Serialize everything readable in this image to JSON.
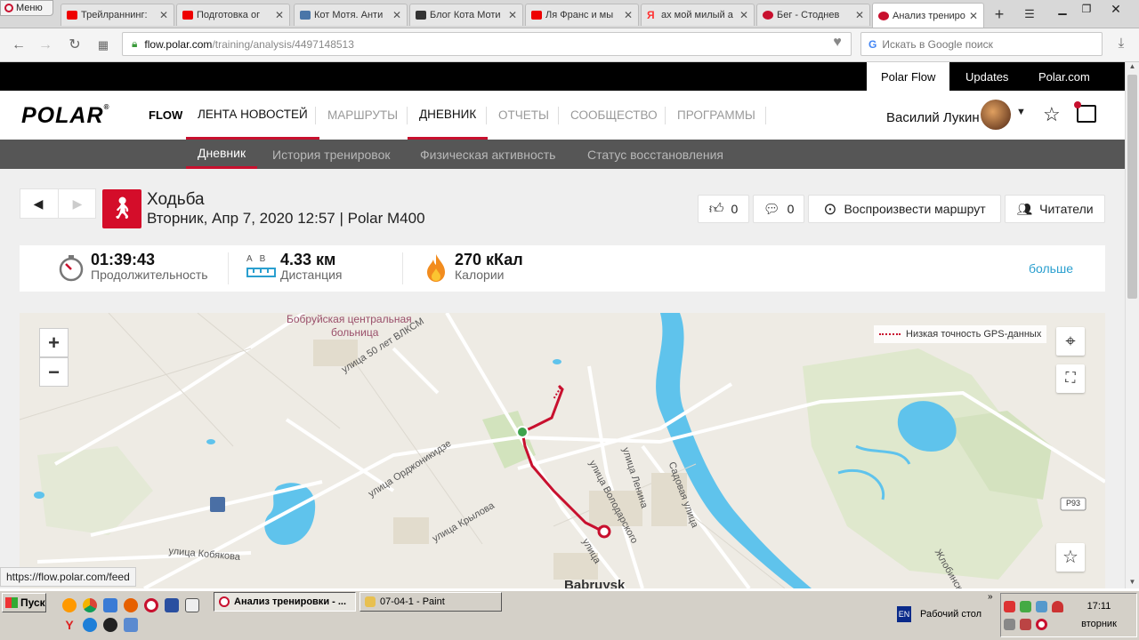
{
  "browser": {
    "menu_label": "Меню",
    "tabs": [
      {
        "title": "Трейлраннинг: ",
        "icon_color": "#e00"
      },
      {
        "title": "Подготовка ог",
        "icon_color": "#e00"
      },
      {
        "title": "Кот Мотя. Анти",
        "icon_color": "#4a76a8"
      },
      {
        "title": "Блог Кота Моти",
        "icon_color": "#333"
      },
      {
        "title": "Ля Франс и мы",
        "icon_color": "#e00"
      },
      {
        "title": "ах мой милый а",
        "icon_color": "#f33"
      },
      {
        "title": "Бег - Стоднев",
        "icon_color": "#c8102e"
      },
      {
        "title": "Анализ трениро",
        "icon_color": "#c8102e"
      }
    ],
    "url_domain": "flow.polar.com",
    "url_path": "/training/analysis/4497148513",
    "search_placeholder": "Искать в Google поиск",
    "status_url": "https://flow.polar.com/feed"
  },
  "polar": {
    "top_links": [
      "Polar Flow",
      "Updates",
      "Polar.com"
    ],
    "logo": "POLAR",
    "flow_label": "FLOW",
    "nav": [
      "ЛЕНТА НОВОСТЕЙ",
      "МАРШРУТЫ",
      "ДНЕВНИК",
      "ОТЧЕТЫ",
      "СООБЩЕСТВО",
      "ПРОГРАММЫ"
    ],
    "user_name": "Василий Лукин",
    "subnav": [
      "Дневник",
      "История тренировок",
      "Физическая активность",
      "Статус восстановления"
    ]
  },
  "session": {
    "sport": "Ходьба",
    "date_device": "Вторник, Апр 7, 2020 12:57 | Polar M400",
    "likes": "0",
    "comments": "0",
    "replay_label": "Воспроизвести маршрут",
    "readers_label": "Читатели"
  },
  "summary": {
    "duration_value": "01:39:43",
    "duration_label": "Продолжительность",
    "distance_value": "4.33 км",
    "distance_label": "Дистанция",
    "distance_icon_letters": "A  B",
    "calories_value": "270 кКал",
    "calories_label": "Калории",
    "more_label": "больше"
  },
  "map": {
    "gps_note": "Низкая точность GPS-данных",
    "labels": {
      "hospital_line1": "Бобруйская центральная",
      "hospital_line2": "больница",
      "street_vlksm": "улица 50 лет ВЛКСМ",
      "street_ordzh": "улица Орджоникидзе",
      "street_krylova": "улица Крылова",
      "street_kobyakova": "улица Кобякова",
      "street_volodarsk": "улица Володарского",
      "street_lenina": "улица Ленина",
      "street_sadovaya": "Садовая улица",
      "street_zhlobin": "Жлобинская",
      "street_ulitsa": "улица",
      "road_sign": "Р93",
      "city": "Babruysk"
    },
    "route_color": "#c8102e",
    "water_color": "#5fc3ec"
  },
  "taskbar": {
    "start_label": "Пуск",
    "tasks": [
      "Анализ тренировки - ...",
      "07-04-1 - Paint"
    ],
    "desktop_label": "Рабочий стол",
    "lang": "EN",
    "time": "17:11",
    "day": "вторник"
  }
}
